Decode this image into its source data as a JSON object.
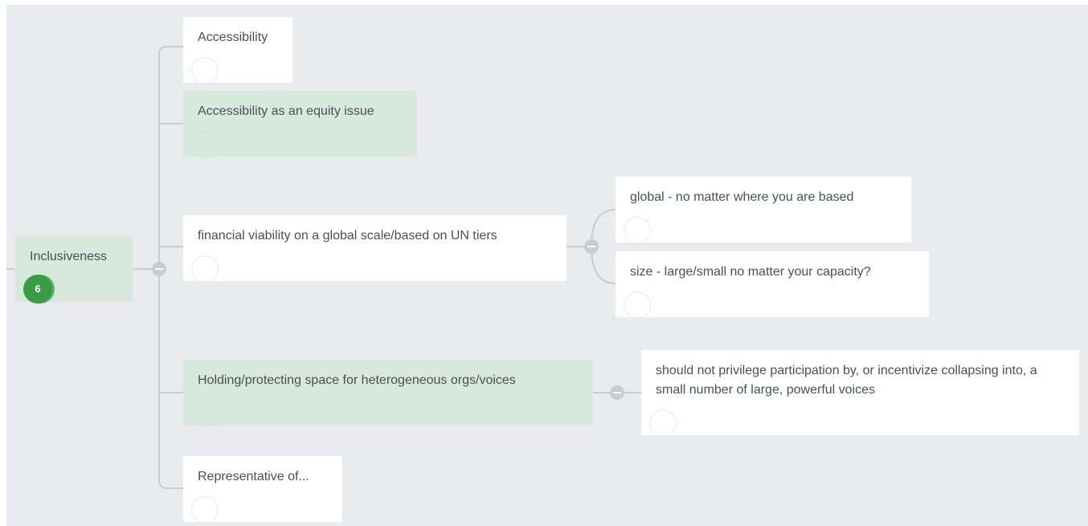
{
  "root": {
    "label": "Inclusiveness",
    "count": "6"
  },
  "branches": [
    {
      "label": "Accessibility"
    },
    {
      "label": "Accessibility as an equity issue"
    },
    {
      "label": "financial viability on a global scale/based on UN tiers",
      "children": [
        {
          "label": "global - no matter where you are based"
        },
        {
          "label": "size - large/small no matter your capacity?"
        }
      ]
    },
    {
      "label": "Holding/protecting space for heterogeneous orgs/voices",
      "children": [
        {
          "label": "should not privilege participation by, or incentivize collapsing into, a small number of large, powerful voices"
        }
      ]
    },
    {
      "label": "Representative of..."
    }
  ],
  "colors": {
    "canvas": "#e9ebee",
    "node_white": "#ffffff",
    "node_green": "#d6e9dc",
    "badge": "#3b9a46",
    "connector": "#c9ccd1"
  }
}
